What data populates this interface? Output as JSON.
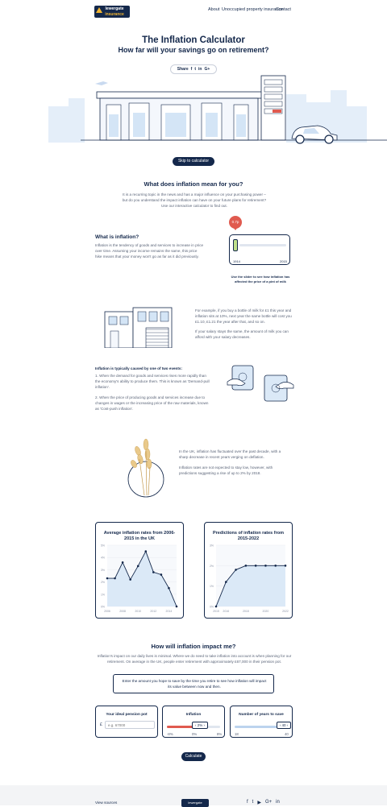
{
  "header": {
    "logo_line1": "lewergate",
    "logo_line2": "insurance",
    "nav": [
      "About",
      "Unoccupied property insurance",
      "Contact"
    ]
  },
  "hero": {
    "title": "The Inflation Calculator",
    "subtitle": "How far will your savings go on retirement?",
    "share_label": "Share",
    "share_icons": [
      "facebook-icon",
      "twitter-icon",
      "linkedin-icon",
      "google-plus-icon"
    ],
    "skip_button": "Skip to calculator"
  },
  "intro": {
    "title": "What does inflation mean for you?",
    "text": "It is a recurring topic in the news and has a major influence on your purchasing power – but do you understand the impact inflation can have on your future plans for retirement? Use our interactive calculator to find out."
  },
  "what_is": {
    "title": "What is inflation?",
    "text": "Inflation is the tendency of goods and services to increase in price over time. Assuming your income remains the same, this price hike means that your money won't go as far as it did previously."
  },
  "milk_widget": {
    "price": "0.7p",
    "year_start": "1914",
    "year_end": "2015",
    "caption": "Use the slider to see how inflation has affected the price of a pint of milk"
  },
  "example": {
    "p1": "For example, if you buy a bottle of milk for £1 this year and inflation sits at 10%, next year the same bottle will cost you £1.10, £1.21 the year after that, and so on.",
    "p2": "If your salary stays the same, the amount of milk you can afford with your salary decreases."
  },
  "causes": {
    "title": "Inflation is typically caused by one of two events:",
    "item1": "When the demand for goods and services rises more rapidly than the economy's ability to produce them. This is known as 'Demand-pull inflation'.",
    "item2": "When the price of producing goods and services increase due to changes in wages or the increasing price of the raw materials, known as 'Cost-push inflation'."
  },
  "uk": {
    "p1": "In the UK, inflation has fluctuated over the past decade, with a sharp decrease in recent years verging on deflation.",
    "p2": "Inflation rates are not expected to stay low, however, with predictions suggesting a rise of up to 2% by 2018."
  },
  "chart_data": [
    {
      "type": "line",
      "title": "Average inflation rates from 2006-2015 in the UK",
      "categories": [
        "2006",
        "2007",
        "2008",
        "2009",
        "2010",
        "2011",
        "2012",
        "2013",
        "2014",
        "2015"
      ],
      "values": [
        2.3,
        2.3,
        3.6,
        2.2,
        3.3,
        4.5,
        2.8,
        2.6,
        1.5,
        0.0
      ],
      "ylim": [
        0,
        5
      ],
      "y_ticks": [
        "0%",
        "1%",
        "2%",
        "3%",
        "4%",
        "5%"
      ],
      "x_tick_labels": [
        "2006",
        "2008",
        "2010",
        "2012",
        "2014"
      ]
    },
    {
      "type": "line",
      "title": "Predictions of inflation rates from 2015-2022",
      "categories": [
        "2015",
        "2016",
        "2017",
        "2018",
        "2019",
        "2020",
        "2021",
        "2022"
      ],
      "values": [
        0.0,
        1.2,
        1.8,
        2.0,
        2.0,
        2.0,
        2.0,
        2.0
      ],
      "ylim": [
        0,
        3
      ],
      "y_ticks": [
        "0%",
        "1%",
        "2%",
        "3%"
      ],
      "x_tick_labels": [
        "2015",
        "2016",
        "2018",
        "2020",
        "2022"
      ]
    }
  ],
  "impact": {
    "title": "How will inflation impact me?",
    "text": "Inflation's impact on our daily lives is minimal. Where we do need to take inflation into account is when planning for our retirement. On average in the UK, people enter retirement with approximately £67,000 in their pension pot.",
    "prompt": "Enter the amount you hope to save by the time you retire to see how inflation will impact its value between now and then."
  },
  "calc": {
    "pot_label": "Your ideal pension pot",
    "currency": "£",
    "pot_placeholder": "e.g. 67000",
    "inflation_label": "Inflation",
    "inflation_value": "2%",
    "inflation_min": "-8%",
    "inflation_mid": "0%",
    "inflation_max": "8%",
    "years_label": "Number of years to save",
    "years_value": "40",
    "years_min": "18",
    "years_max": "40",
    "calculate": "Calculate"
  },
  "footer": {
    "sources": "View sources"
  },
  "colors": {
    "navy": "#14284b",
    "light_blue": "#dbe9f7",
    "red": "#e05a4f",
    "gold": "#f2b632"
  }
}
